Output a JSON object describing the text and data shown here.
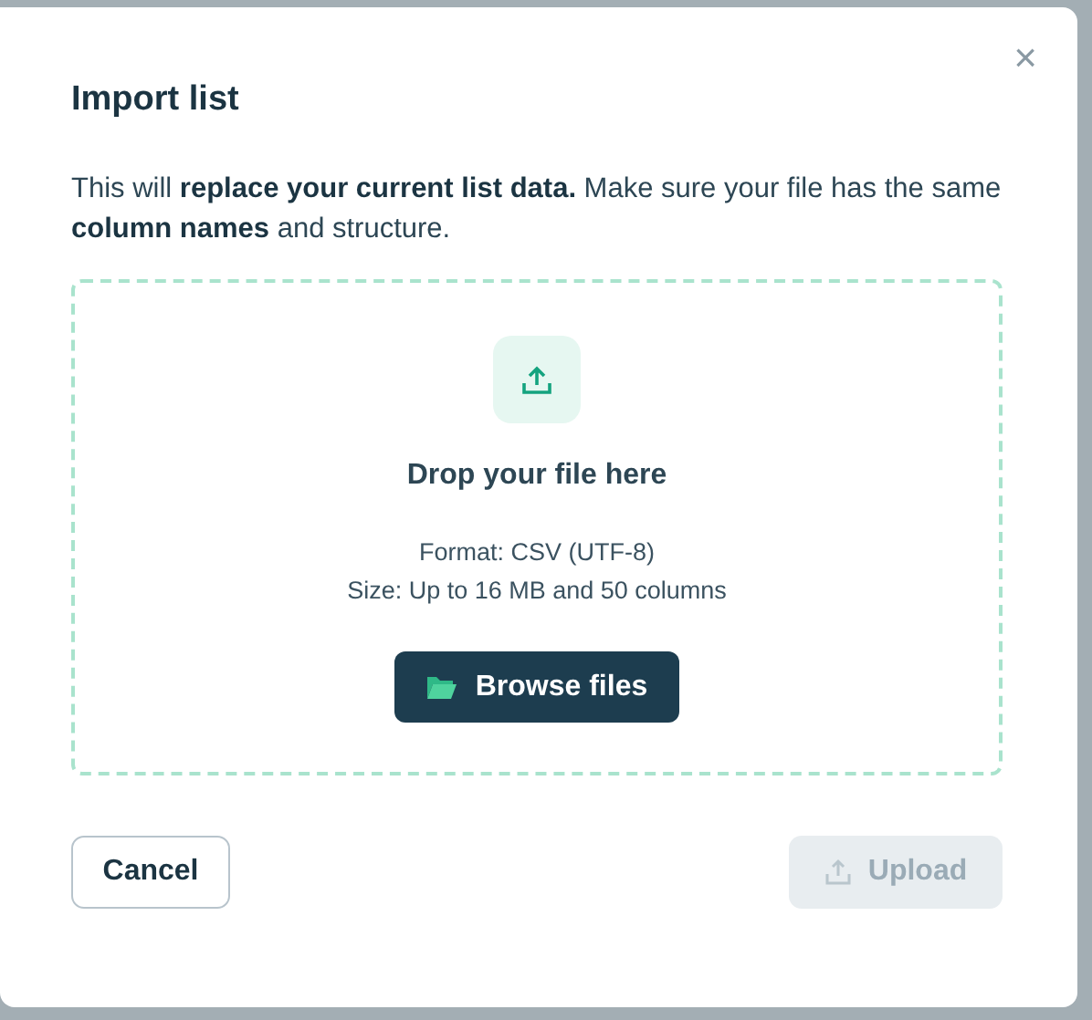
{
  "dialog": {
    "title": "Import list",
    "close": "×",
    "description": "This will **replace your current list data.** Make sure your file has the same **column names** and structure."
  },
  "dropzone": {
    "heading": "Drop your file here",
    "details": [
      "Format: CSV (UTF-8)",
      "Size: Up to 16 MB and 50 columns"
    ],
    "browse_button": "Browse files"
  },
  "buttons": [
    {
      "kind": "secondary",
      "label": "Cancel",
      "disabled": false
    },
    {
      "kind": "primary",
      "label": "Upload",
      "disabled": true
    }
  ]
}
